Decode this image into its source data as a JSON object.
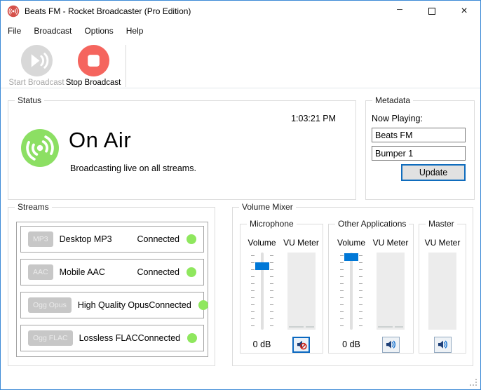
{
  "window": {
    "title": "Beats FM - Rocket Broadcaster (Pro Edition)",
    "controls": {
      "minimize": "─",
      "close": "×"
    },
    "icons": {
      "app": "red-broadcast-icon",
      "resize": "resize-grip"
    }
  },
  "menu": {
    "items": [
      {
        "label": "File"
      },
      {
        "label": "Broadcast"
      },
      {
        "label": "Options"
      },
      {
        "label": "Help"
      }
    ]
  },
  "toolbar": {
    "start": {
      "label": "Start Broadcast",
      "enabled": false,
      "icon": "play-broadcast-icon"
    },
    "stop": {
      "label": "Stop Broadcast",
      "enabled": true,
      "icon": "stop-icon"
    }
  },
  "status": {
    "group_label": "Status",
    "clock": "1:03:21 PM",
    "headline": "On Air",
    "message": "Broadcasting live on all streams.",
    "icon": "on-air-broadcast-icon"
  },
  "metadata": {
    "group_label": "Metadata",
    "now_playing_label": "Now Playing:",
    "station_field": "Beats FM",
    "track_field": "Bumper 1",
    "update_button": "Update"
  },
  "streams": {
    "group_label": "Streams",
    "items": [
      {
        "badge": "MP3",
        "name": "Desktop MP3",
        "status": "Connected"
      },
      {
        "badge": "AAC",
        "name": "Mobile AAC",
        "status": "Connected"
      },
      {
        "badge": "Ogg Opus",
        "name": "High Quality Opus",
        "status": "Connected"
      },
      {
        "badge": "Ogg FLAC",
        "name": "Lossless FLAC",
        "status": "Connected"
      }
    ]
  },
  "mixer": {
    "group_label": "Volume Mixer",
    "channels": [
      {
        "label": "Microphone",
        "volume_label": "Volume",
        "vu_label": "VU Meter",
        "db": "0 dB",
        "muted": true
      },
      {
        "label": "Other Applications",
        "volume_label": "Volume",
        "vu_label": "VU Meter",
        "db": "0 dB",
        "muted": false
      },
      {
        "label": "Master",
        "vu_label": "VU Meter",
        "muted": false
      }
    ]
  },
  "colors": {
    "on_air_green": "#8cdf63",
    "connected_green": "#8fe75e",
    "stop_red": "#f5655e",
    "disabled_gray": "#d8d8d8",
    "accent_blue": "#0078d7",
    "speaker_navy": "#1d3f77",
    "speaker_wave_blue": "#1c76d2",
    "mute_red": "#cf2318",
    "window_border_blue": "#3c8ad6"
  }
}
